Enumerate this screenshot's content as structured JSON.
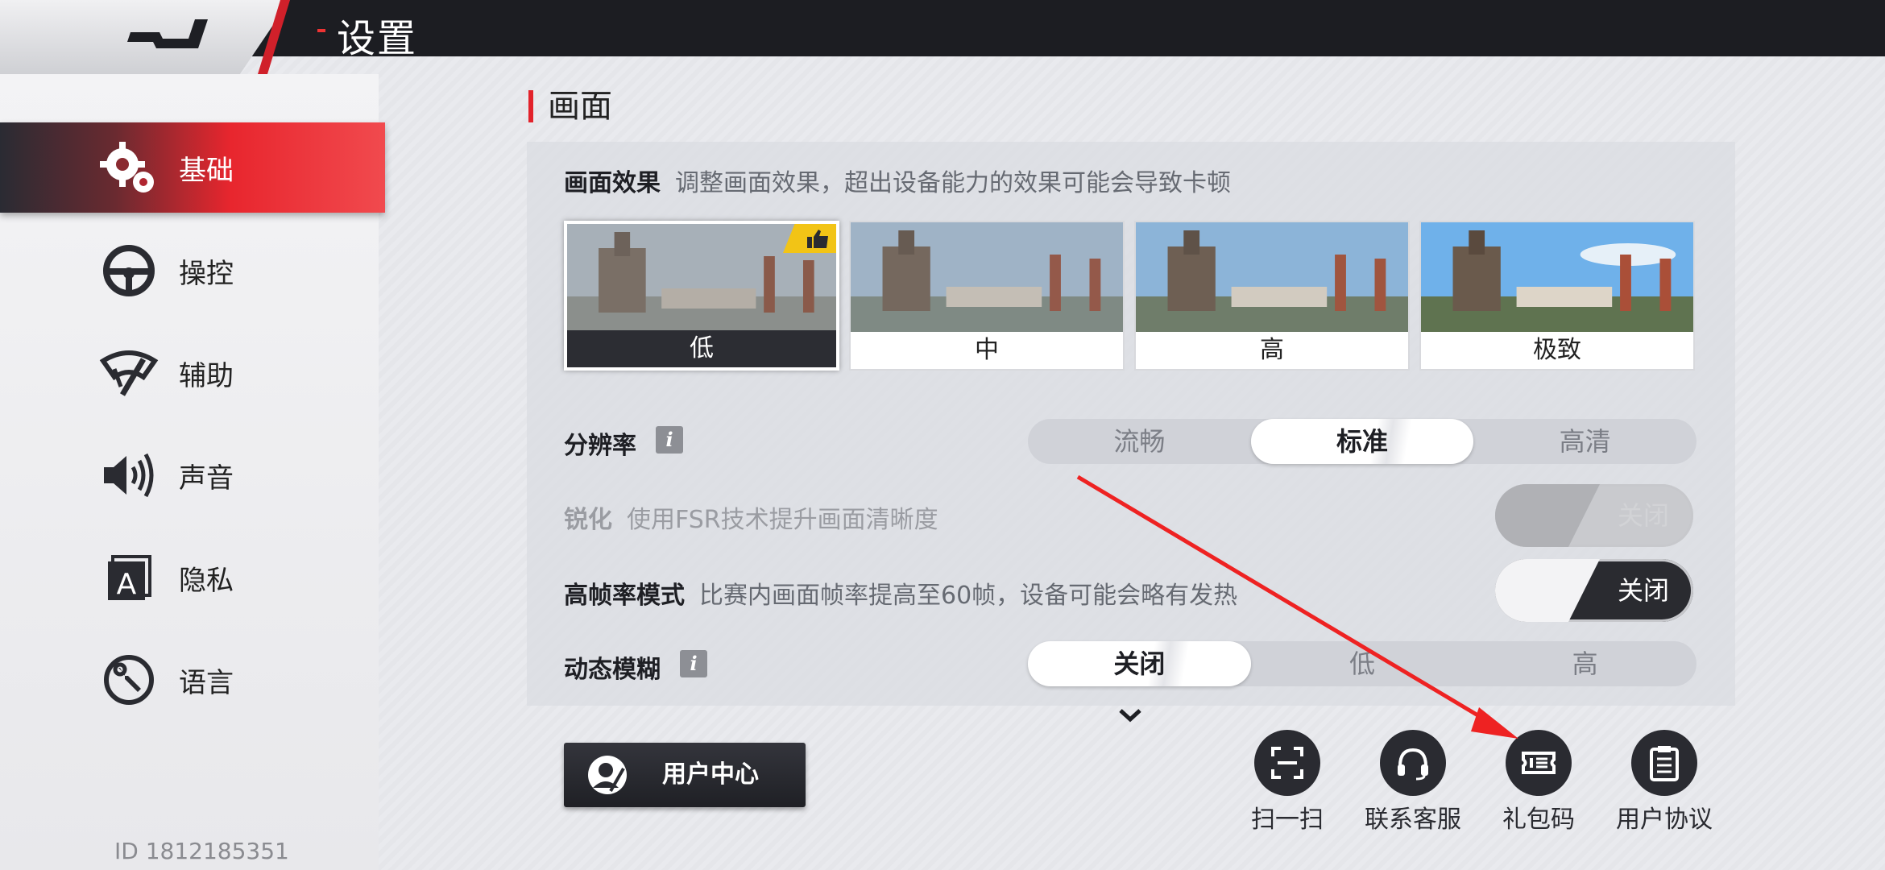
{
  "header": {
    "title": "设置",
    "back_icon": "back-arrow-icon"
  },
  "sidebar": {
    "items": [
      {
        "label": "基础",
        "icon": "gears-icon",
        "active": true
      },
      {
        "label": "操控",
        "icon": "steering-wheel-icon",
        "active": false
      },
      {
        "label": "辅助",
        "icon": "wiper-icon",
        "active": false
      },
      {
        "label": "声音",
        "icon": "speaker-icon",
        "active": false
      },
      {
        "label": "隐私",
        "icon": "privacy-icon",
        "active": false
      },
      {
        "label": "语言",
        "icon": "wrench-icon",
        "active": false
      }
    ],
    "user_id": "ID 1812185351"
  },
  "main": {
    "section_title": "画面",
    "graphics_effect": {
      "label": "画面效果",
      "desc": "调整画面效果，超出设备能力的效果可能会导致卡顿",
      "options": [
        "低",
        "中",
        "高",
        "极致"
      ],
      "selected": "低",
      "recommended_icon": "thumbs-up-icon"
    },
    "resolution": {
      "label": "分辨率",
      "info_icon": "i",
      "options": [
        "流畅",
        "标准",
        "高清"
      ],
      "selected": "标准"
    },
    "sharpen": {
      "label": "锐化",
      "desc": "使用FSR技术提升画面清晰度",
      "toggle_text": "关闭",
      "enabled": false
    },
    "high_fps": {
      "label": "高帧率模式",
      "desc": "比赛内画面帧率提高至60帧，设备可能会略有发热",
      "toggle_text": "关闭"
    },
    "motion_blur": {
      "label": "动态模糊",
      "info_icon": "i",
      "options": [
        "关闭",
        "低",
        "高"
      ],
      "selected": "关闭"
    }
  },
  "footer": {
    "user_center": "用户中心",
    "buttons": [
      {
        "label": "扫一扫",
        "icon": "scan-icon"
      },
      {
        "label": "联系客服",
        "icon": "headset-icon"
      },
      {
        "label": "礼包码",
        "icon": "gift-code-icon"
      },
      {
        "label": "用户协议",
        "icon": "clipboard-icon"
      }
    ]
  },
  "colors": {
    "accent": "#e2222b",
    "dark": "#2a2b31",
    "badge": "#f2c416"
  }
}
